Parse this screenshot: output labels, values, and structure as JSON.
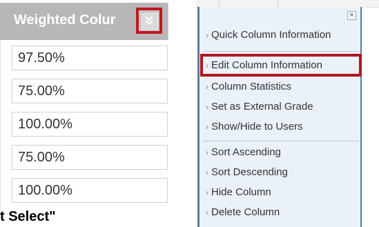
{
  "column": {
    "header_title": "Weighted Colur",
    "menu_button_icon": "double-chevron-down-icon",
    "values": [
      "97.50%",
      "75.00%",
      "100.00%",
      "75.00%",
      "100.00%"
    ]
  },
  "menu": {
    "close_glyph": "×",
    "chevron": "›",
    "groups": [
      [
        "Quick Column Information"
      ],
      [
        "Edit Column Information",
        "Column Statistics",
        "Set as External Grade",
        "Show/Hide to Users"
      ],
      [
        "Sort Ascending",
        "Sort Descending",
        "Hide Column",
        "Delete Column"
      ]
    ],
    "highlighted_item": "Edit Column Information"
  },
  "footer_text": "t Select\"",
  "colors": {
    "highlight_border": "#b0161f",
    "menu_background": "#eaf1f8",
    "menu_border": "#5f7aa0",
    "header_background": "#b7b7b7"
  }
}
